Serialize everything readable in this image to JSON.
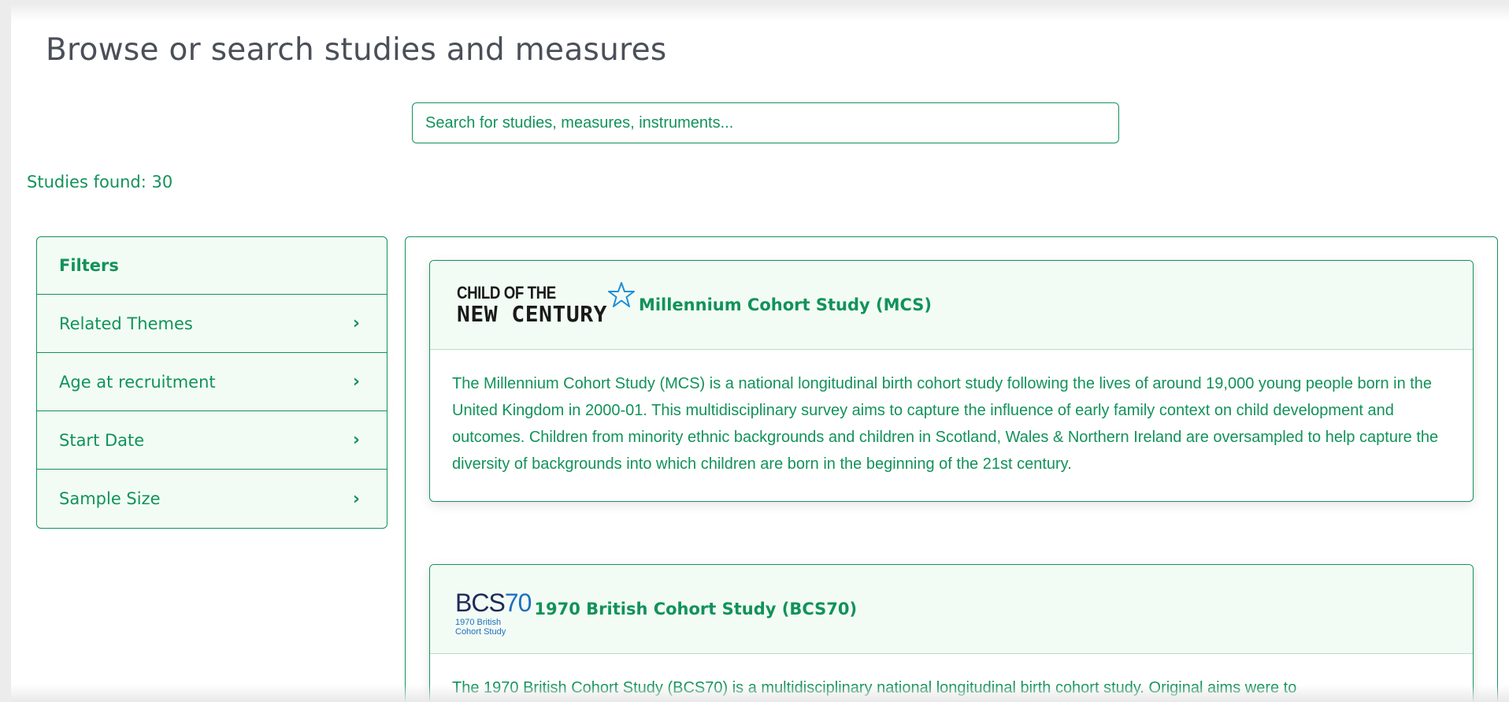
{
  "page": {
    "title": "Browse or search studies and measures"
  },
  "search": {
    "placeholder": "Search for studies, measures, instruments..."
  },
  "results": {
    "count_text": "Studies found: 30"
  },
  "filters": {
    "header": "Filters",
    "items": [
      {
        "label": "Related Themes"
      },
      {
        "label": "Age at recruitment"
      },
      {
        "label": "Start Date"
      },
      {
        "label": "Sample Size"
      }
    ]
  },
  "studies": [
    {
      "logo_line1": "CHILD OF THE",
      "logo_line2": "NEW CENTURY",
      "title": "Millennium Cohort Study (MCS)",
      "description": "The Millennium Cohort Study (MCS) is a national longitudinal birth cohort study following the lives of around 19,000 young people born in the United Kingdom in 2000-01. This multidisciplinary survey aims to capture the influence of early family context on child development and outcomes. Children from minority ethnic backgrounds and children in Scotland, Wales & Northern Ireland are oversampled to help capture the diversity of backgrounds into which children are born in the beginning of the 21st century."
    },
    {
      "logo_main_a": "BCS",
      "logo_main_b": "70",
      "logo_sub1": "1970 British",
      "logo_sub2": "Cohort Study",
      "title": "1970 British Cohort Study (BCS70)",
      "description": "The 1970 British Cohort Study (BCS70) is a multidisciplinary national longitudinal birth cohort study. Original aims were to"
    }
  ],
  "colors": {
    "accent": "#12925a",
    "card_header_bg": "#f2fcf4",
    "title_text": "#4b4f58"
  }
}
